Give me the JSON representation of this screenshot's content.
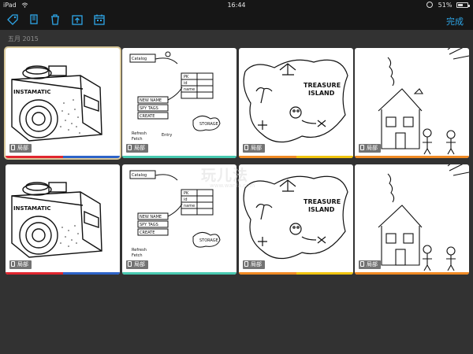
{
  "status_bar": {
    "device": "iPad",
    "time": "16:44",
    "battery": "51%"
  },
  "toolbar": {
    "done_label": "完成",
    "icons": [
      "tag-icon",
      "copy-icon",
      "trash-icon",
      "export-icon",
      "calendar-icon"
    ]
  },
  "section": {
    "label": "五月 2015"
  },
  "colors": {
    "accent": "#2ea6e8",
    "red": "#e0262f",
    "blue": "#2d63c8",
    "yellow": "#f1c40f",
    "orange": "#f08a24",
    "teal": "#48c9b0"
  },
  "cards": [
    {
      "title": "camera-sketch",
      "badge": "局部",
      "strip": [
        "#e0262f",
        "#2d63c8"
      ]
    },
    {
      "title": "database-sketch",
      "badge": "局部",
      "strip": [
        "#48c9b0"
      ]
    },
    {
      "title": "treasure-map-sketch",
      "badge": "局部",
      "strip": [
        "#f08a24",
        "#f1c40f"
      ]
    },
    {
      "title": "house-sketch",
      "badge": "局部",
      "strip": [
        "#f08a24"
      ]
    },
    {
      "title": "camera-sketch",
      "badge": "局部",
      "strip": [
        "#e0262f",
        "#2d63c8"
      ]
    },
    {
      "title": "database-sketch",
      "badge": "局部",
      "strip": [
        "#48c9b0"
      ]
    },
    {
      "title": "treasure-map-sketch",
      "badge": "局部",
      "strip": [
        "#f08a24",
        "#f1c40f"
      ]
    },
    {
      "title": "house-sketch",
      "badge": "局部",
      "strip": [
        "#f08a24"
      ]
    }
  ],
  "map_text": [
    "TREASURE",
    "ISLAND"
  ],
  "watermark": {
    "text": "玩儿法",
    "sub": "www.wanfa.com"
  }
}
